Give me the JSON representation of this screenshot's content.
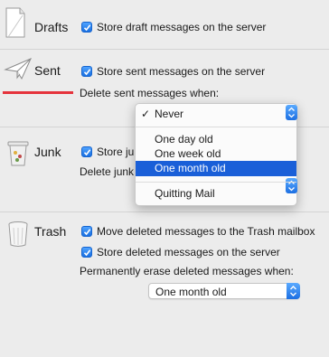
{
  "drafts": {
    "label": "Drafts",
    "store_label": "Store draft messages on the server",
    "store_checked": true
  },
  "sent": {
    "label": "Sent",
    "store_label": "Store sent messages on the server",
    "store_checked": true,
    "delete_label": "Delete sent messages when:"
  },
  "junk": {
    "label": "Junk",
    "store_label_partial": "Store jun",
    "store_checked": true,
    "delete_label_partial": "Delete junk"
  },
  "trash": {
    "label": "Trash",
    "move_label": "Move deleted messages to the Trash mailbox",
    "move_checked": true,
    "store_label": "Store deleted messages on the server",
    "store_checked": true,
    "erase_label": "Permanently erase deleted messages when:",
    "erase_value": "One month old"
  },
  "menu": {
    "items": [
      "Never",
      "One day old",
      "One week old",
      "One month old",
      "Quitting Mail"
    ],
    "checked_item": "Never",
    "highlighted_item": "One month old",
    "accent": "#1a5fd8"
  },
  "icons": {
    "drafts": "drafts-page-icon",
    "sent": "paper-plane-icon",
    "junk": "junk-bin-icon",
    "trash": "trash-can-icon"
  }
}
